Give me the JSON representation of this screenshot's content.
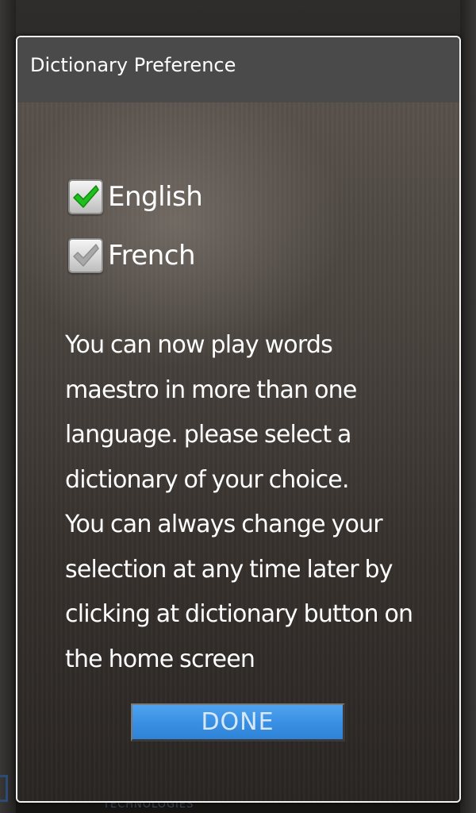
{
  "background": {
    "brand_text": "TECHNOLOGIES"
  },
  "dialog": {
    "title": "Dictionary Preference",
    "options": [
      {
        "label": "English",
        "checked": true,
        "check_color": "#1fbf1f"
      },
      {
        "label": "French",
        "checked": false,
        "check_color": "#9a9a9a"
      }
    ],
    "message_lines": [
      "You can now play words",
      "maestro in more than one",
      "language. please select a",
      "dictionary of your choice.",
      "You can always change your",
      "selection at any time later by",
      "clicking at dictionary button on",
      "the home screen"
    ],
    "done_label": "DONE"
  },
  "colors": {
    "title_bar": "#4a4a4a",
    "done_button": "#3a90e3",
    "dialog_border": "#f2f2f2"
  }
}
